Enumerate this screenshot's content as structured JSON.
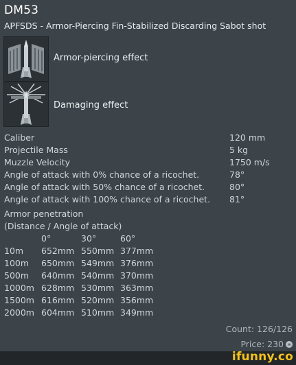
{
  "header": {
    "title": "DM53",
    "subtitle": "APFSDS - Armor-Piercing Fin-Stabilized Discarding Sabot shot"
  },
  "effects": [
    {
      "label": "Armor-piercing effect",
      "icon": "shell-armor-piercing-icon"
    },
    {
      "label": "Damaging effect",
      "icon": "shell-damaging-icon"
    }
  ],
  "stats": [
    {
      "label": "Caliber",
      "value": "120 mm"
    },
    {
      "label": "Projectile Mass",
      "value": "5 kg"
    },
    {
      "label": "Muzzle Velocity",
      "value": "1750 m/s"
    },
    {
      "label": "Angle of attack with 0% chance of a ricochet.",
      "value": "78°"
    },
    {
      "label": "Angle of attack with 50% chance of a ricochet.",
      "value": "80°"
    },
    {
      "label": "Angle of attack with 100% chance of a ricochet.",
      "value": "81°"
    }
  ],
  "penetration": {
    "title": "Armor penetration",
    "subtitle": "(Distance / Angle of attack)",
    "angles": [
      "0°",
      "30°",
      "60°"
    ],
    "rows": [
      {
        "distance": "10m",
        "values": [
          "652mm",
          "550mm",
          "377mm"
        ]
      },
      {
        "distance": "100m",
        "values": [
          "650mm",
          "549mm",
          "376mm"
        ]
      },
      {
        "distance": "500m",
        "values": [
          "640mm",
          "540mm",
          "370mm"
        ]
      },
      {
        "distance": "1000m",
        "values": [
          "628mm",
          "530mm",
          "363mm"
        ]
      },
      {
        "distance": "1500m",
        "values": [
          "616mm",
          "520mm",
          "356mm"
        ]
      },
      {
        "distance": "2000m",
        "values": [
          "604mm",
          "510mm",
          "349mm"
        ]
      }
    ]
  },
  "footer": {
    "count": "Count: 126/126",
    "price": "Price: 230",
    "price_icon": "silver-lion-icon"
  },
  "watermark": "ifunny.co"
}
